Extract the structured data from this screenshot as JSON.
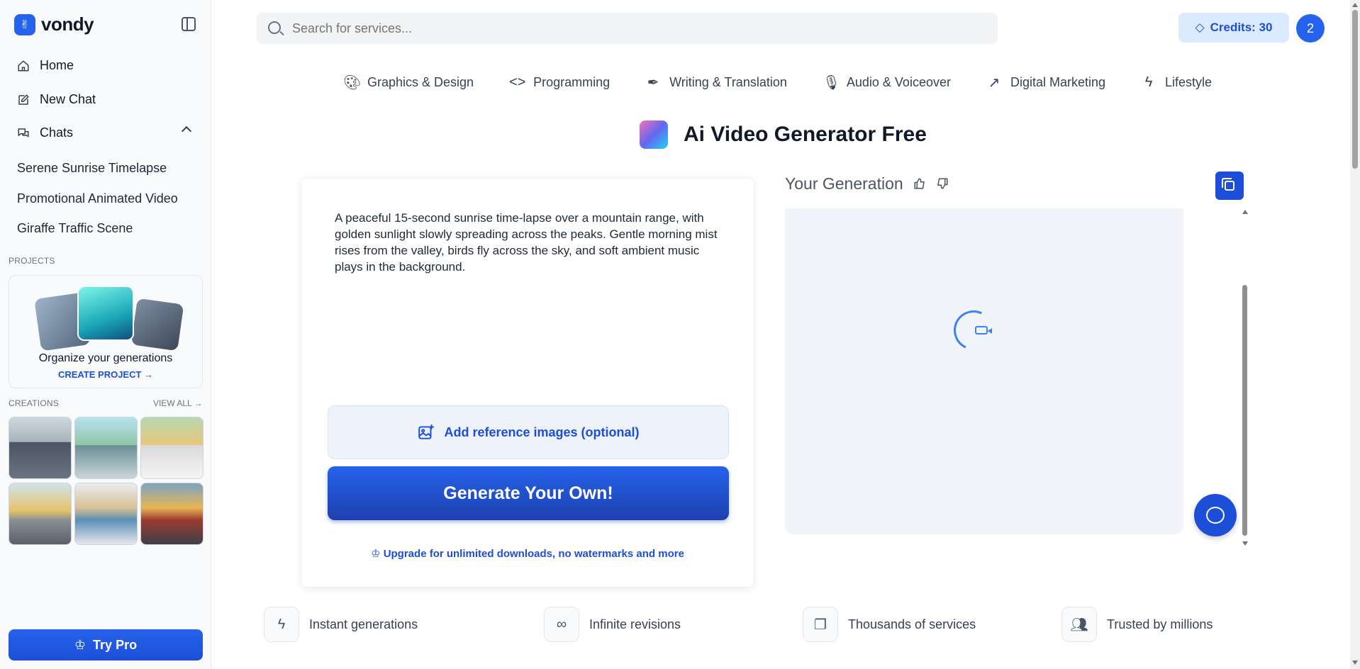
{
  "brand": {
    "name": "vondy",
    "logo_icon": "vondy-logo-icon"
  },
  "sidebar": {
    "nav": [
      {
        "label": "Home",
        "icon": "home-icon"
      },
      {
        "label": "New Chat",
        "icon": "edit-icon"
      },
      {
        "label": "Chats",
        "icon": "chat-icon"
      }
    ],
    "chats": [
      "Serene Sunrise Timelapse",
      "Promotional Animated Video",
      "Giraffe Traffic Scene"
    ],
    "projects_label": "PROJECTS",
    "project_card": {
      "title": "Organize your generations",
      "cta": "CREATE PROJECT"
    },
    "creations_label": "CREATIONS",
    "view_all": "VIEW ALL",
    "try_pro": "Try Pro"
  },
  "search": {
    "placeholder": "Search for services..."
  },
  "credits": {
    "label": "Credits: 30"
  },
  "avatar": {
    "text": "2"
  },
  "categories": [
    {
      "label": "Graphics & Design",
      "icon": "palette-icon"
    },
    {
      "label": "Programming",
      "icon": "code-icon"
    },
    {
      "label": "Writing & Translation",
      "icon": "pen-icon"
    },
    {
      "label": "Audio & Voiceover",
      "icon": "microphone-icon"
    },
    {
      "label": "Digital Marketing",
      "icon": "trending-up-icon"
    },
    {
      "label": "Lifestyle",
      "icon": "lightning-icon"
    }
  ],
  "page": {
    "title": "Ai Video Generator Free"
  },
  "prompt": {
    "text": "A peaceful 15-second sunrise time-lapse over a mountain range, with golden sunlight slowly spreading across the peaks. Gentle morning mist rises from the valley, birds fly across the sky, and soft ambient music plays in the background.",
    "reference_button": "Add reference images (optional)",
    "generate_button": "Generate Your Own!",
    "upgrade_text": "Upgrade for unlimited downloads, no watermarks and more"
  },
  "generation": {
    "title": "Your Generation"
  },
  "features": [
    {
      "label": "Instant generations",
      "icon": "lightning-icon"
    },
    {
      "label": "Infinite revisions",
      "icon": "infinity-icon"
    },
    {
      "label": "Thousands of services",
      "icon": "folders-icon"
    },
    {
      "label": "Trusted by millions",
      "icon": "users-icon"
    }
  ],
  "colors": {
    "accent": "#2563eb",
    "accent_dark": "#1d4ed8",
    "credits_bg": "#dbeafe"
  }
}
